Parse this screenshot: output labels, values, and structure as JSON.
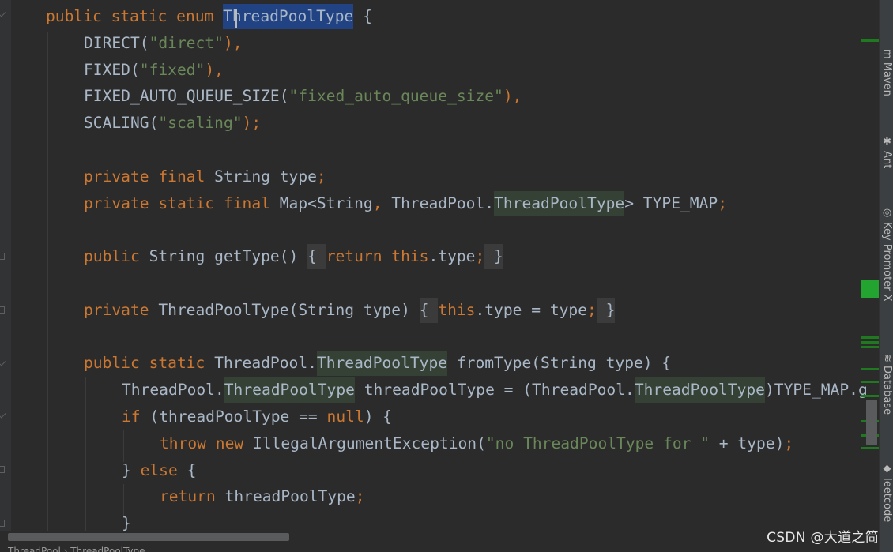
{
  "editor": {
    "lines": [
      [
        {
          "t": "public static enum ",
          "c": "kw"
        },
        {
          "t": "ThreadPoolType",
          "c": "plain",
          "hl": "sel"
        },
        {
          "t": " {",
          "c": "plain"
        }
      ],
      [
        {
          "t": "DIRECT(",
          "c": "plain"
        },
        {
          "t": "\"direct\"",
          "c": "str"
        },
        {
          "t": "),",
          "c": "kw"
        }
      ],
      [
        {
          "t": "FIXED(",
          "c": "plain"
        },
        {
          "t": "\"fixed\"",
          "c": "str"
        },
        {
          "t": "),",
          "c": "kw"
        }
      ],
      [
        {
          "t": "FIXED_AUTO_QUEUE_SIZE(",
          "c": "plain"
        },
        {
          "t": "\"fixed_auto_queue_size\"",
          "c": "str"
        },
        {
          "t": "),",
          "c": "kw"
        }
      ],
      [
        {
          "t": "SCALING(",
          "c": "plain"
        },
        {
          "t": "\"scaling\"",
          "c": "str"
        },
        {
          "t": ");",
          "c": "kw"
        }
      ],
      [],
      [
        {
          "t": "private final ",
          "c": "kw"
        },
        {
          "t": "String type",
          "c": "plain"
        },
        {
          "t": ";",
          "c": "kw"
        }
      ],
      [
        {
          "t": "private static final ",
          "c": "kw"
        },
        {
          "t": "Map<String",
          "c": "plain"
        },
        {
          "t": ", ",
          "c": "kw"
        },
        {
          "t": "ThreadPool.",
          "c": "plain"
        },
        {
          "t": "ThreadPoolType",
          "c": "plain",
          "hl": "ref"
        },
        {
          "t": "> TYPE_MAP",
          "c": "plain"
        },
        {
          "t": ";",
          "c": "kw"
        }
      ],
      [],
      [
        {
          "t": "public ",
          "c": "kw"
        },
        {
          "t": "String getType() ",
          "c": "plain"
        },
        {
          "t": "{ ",
          "c": "plain",
          "hl": "brace"
        },
        {
          "t": "return this",
          "c": "kw"
        },
        {
          "t": ".type",
          "c": "plain"
        },
        {
          "t": ";",
          "c": "kw"
        },
        {
          "t": " }",
          "c": "plain",
          "hl": "brace"
        }
      ],
      [],
      [
        {
          "t": "private ",
          "c": "kw"
        },
        {
          "t": "ThreadPoolType(String type) ",
          "c": "plain"
        },
        {
          "t": "{ ",
          "c": "plain",
          "hl": "brace"
        },
        {
          "t": "this",
          "c": "kw"
        },
        {
          "t": ".type = type",
          "c": "plain"
        },
        {
          "t": ";",
          "c": "kw"
        },
        {
          "t": " }",
          "c": "plain",
          "hl": "brace"
        }
      ],
      [],
      [
        {
          "t": "public static ",
          "c": "kw"
        },
        {
          "t": "ThreadPool.",
          "c": "plain"
        },
        {
          "t": "ThreadPoolType",
          "c": "plain",
          "hl": "ref"
        },
        {
          "t": " fromType(String type) {",
          "c": "plain"
        }
      ],
      [
        {
          "t": "ThreadPool.",
          "c": "plain"
        },
        {
          "t": "ThreadPoolType",
          "c": "plain",
          "hl": "ref"
        },
        {
          "t": " threadPoolType = (ThreadPool.",
          "c": "plain"
        },
        {
          "t": "ThreadPoolType",
          "c": "plain",
          "hl": "ref"
        },
        {
          "t": ")TYPE_MAP.g",
          "c": "plain"
        }
      ],
      [
        {
          "t": "if ",
          "c": "kw"
        },
        {
          "t": "(threadPoolType == ",
          "c": "plain"
        },
        {
          "t": "null",
          "c": "kw"
        },
        {
          "t": ") {",
          "c": "plain"
        }
      ],
      [
        {
          "t": "throw new ",
          "c": "kw"
        },
        {
          "t": "IllegalArgumentException(",
          "c": "plain"
        },
        {
          "t": "\"no ThreadPoolType for \"",
          "c": "str"
        },
        {
          "t": " + type)",
          "c": "plain"
        },
        {
          "t": ";",
          "c": "kw"
        }
      ],
      [
        {
          "t": "} ",
          "c": "plain"
        },
        {
          "t": "else ",
          "c": "kw"
        },
        {
          "t": "{",
          "c": "plain"
        }
      ],
      [
        {
          "t": "return ",
          "c": "kw"
        },
        {
          "t": "threadPoolType",
          "c": "plain"
        },
        {
          "t": ";",
          "c": "kw"
        }
      ],
      [
        {
          "t": "}",
          "c": "plain"
        }
      ]
    ]
  },
  "tool_windows": {
    "maven": "Maven",
    "ant": "Ant",
    "key_promoter": "Key Promoter X",
    "database": "Database",
    "leetcode": "leetcode"
  },
  "breadcrumbs": "ThreadPool  ›  ThreadPoolType",
  "watermark": "CSDN @大道之简",
  "colors": {
    "background": "#2b2b2b",
    "keyword": "#cc7832",
    "string": "#6a8759",
    "text": "#a9b7c6",
    "selection": "#214283",
    "usage_highlight": "#344134"
  }
}
